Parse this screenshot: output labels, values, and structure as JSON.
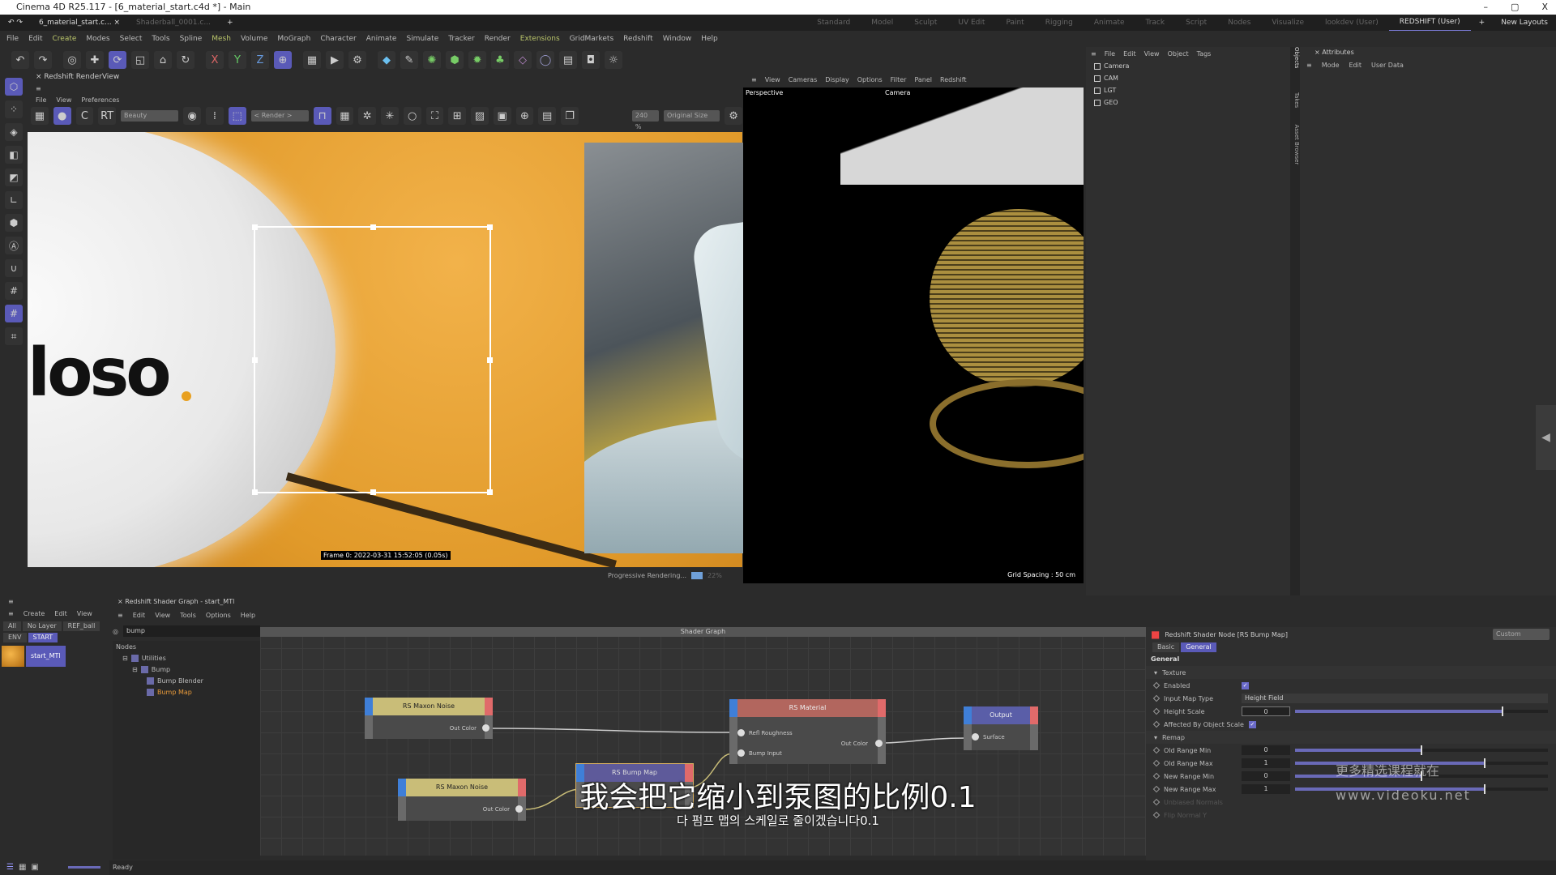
{
  "window": {
    "title": "Cinema 4D R25.117 - [6_material_start.c4d *] - Main",
    "controls": [
      "–",
      "▢",
      "X"
    ]
  },
  "doc_tabs": [
    {
      "label": "6_material_start.c...",
      "active": true
    },
    {
      "label": "Shaderball_0001.c...",
      "active": false
    }
  ],
  "layouts": [
    "Standard",
    "Model",
    "Sculpt",
    "UV Edit",
    "Paint",
    "Rigging",
    "Animate",
    "Track",
    "Script",
    "Nodes",
    "Visualize",
    "lookdev (User)",
    "REDSHIFT (User)"
  ],
  "active_layout": "REDSHIFT (User)",
  "new_layouts": "New Layouts",
  "menu": [
    "File",
    "Edit",
    "Create",
    "Modes",
    "Select",
    "Tools",
    "Spline",
    "Mesh",
    "Volume",
    "MoGraph",
    "Character",
    "Animate",
    "Simulate",
    "Tracker",
    "Render",
    "Extensions",
    "GridMarkets",
    "Redshift",
    "Window",
    "Help"
  ],
  "toolbar_axes": [
    "X",
    "Y",
    "Z"
  ],
  "renderview": {
    "title": "Redshift RenderView",
    "menu": [
      "File",
      "View",
      "Preferences"
    ],
    "aov": "Beauty",
    "render_select": "< Render >",
    "zoom": "240 %",
    "size": "Original Size",
    "rt": "RT",
    "frame_info": "Frame 0:  2022-03-31  15:52:05  (0.05s)",
    "progress_label": "Progressive Rendering...",
    "progress_percent": "22%",
    "render_text": "loso"
  },
  "viewport": {
    "menu": [
      "View",
      "Cameras",
      "Display",
      "Options",
      "Filter",
      "Panel",
      "Redshift"
    ],
    "view_name": "Perspective",
    "camera": "Camera",
    "grid_spacing": "Grid Spacing : 50 cm"
  },
  "objects": {
    "menu": [
      "File",
      "Edit",
      "View",
      "Object",
      "Tags"
    ],
    "items": [
      "Camera",
      "CAM",
      "LGT",
      "GEO"
    ],
    "side_tabs": [
      "Objects",
      "Takes",
      "Asset Browser"
    ]
  },
  "attributes": {
    "title": "Attributes",
    "menu": [
      "Mode",
      "Edit",
      "User Data"
    ]
  },
  "material_manager": {
    "menu": [
      "Create",
      "Edit",
      "View"
    ],
    "filters": [
      "All",
      "No Layer",
      "REF_ball",
      "ENV",
      "START"
    ],
    "active_filter": "START",
    "material": "start_MTl"
  },
  "shader_graph": {
    "title": "Redshift Shader Graph - start_MTl",
    "menu": [
      "Edit",
      "View",
      "Tools",
      "Options",
      "Help"
    ],
    "search": "bump",
    "tree_header": "Nodes",
    "tree": [
      "Utilities",
      "Bump",
      "Bump Blender",
      "Bump Map"
    ],
    "graph_title": "Shader Graph",
    "nodes": {
      "noise1": {
        "title": "RS Maxon Noise",
        "out": "Out Color"
      },
      "noise2": {
        "title": "RS Maxon Noise",
        "out": "Out Color"
      },
      "bump": {
        "title": "RS Bump Map"
      },
      "material": {
        "title": "RS Material",
        "in1": "Refl Roughness",
        "in2": "Bump Input",
        "out": "Out Color"
      },
      "output": {
        "title": "Output",
        "in": "Surface"
      }
    }
  },
  "node_attrs": {
    "title": "Redshift Shader Node [RS Bump Map]",
    "preset": "Custom",
    "tabs": [
      "Basic",
      "General"
    ],
    "active_tab": "General",
    "section": "General",
    "texture_group": "Texture",
    "enabled_label": "Enabled",
    "enabled": true,
    "input_map_type_label": "Input Map Type",
    "input_map_type": "Height Field",
    "height_scale_label": "Height Scale",
    "height_scale": "0",
    "height_scale_slider": 0.82,
    "affected_label": "Affected By Object Scale",
    "affected": true,
    "remap_group": "Remap",
    "remap": [
      {
        "label": "Old Range Min",
        "value": "0",
        "slider": 0.5
      },
      {
        "label": "Old Range Max",
        "value": "1",
        "slider": 0.75
      },
      {
        "label": "New Range Min",
        "value": "0",
        "slider": 0.5
      },
      {
        "label": "New Range Max",
        "value": "1",
        "slider": 0.75
      }
    ],
    "disabled": [
      "Unbiased Normals",
      "Flip Normal Y"
    ]
  },
  "status": "Ready",
  "subtitles": {
    "zh": "我会把它缩小到泵图的比例0.1",
    "ko": "다 펌프 맵의 스케일로 줄이겠습니다0.1"
  },
  "watermark": {
    "line1": "更多精选课程就在",
    "line2": "www.videoku.net"
  },
  "colors": {
    "accent": "#5a5ab8",
    "node_input": "#3f7fd8",
    "node_output": "#e06a6a",
    "noise_header": "#c9bd78",
    "material_header": "#b2665e",
    "bump_header": "#5e5a9a",
    "output_header": "#5a5ea8"
  }
}
